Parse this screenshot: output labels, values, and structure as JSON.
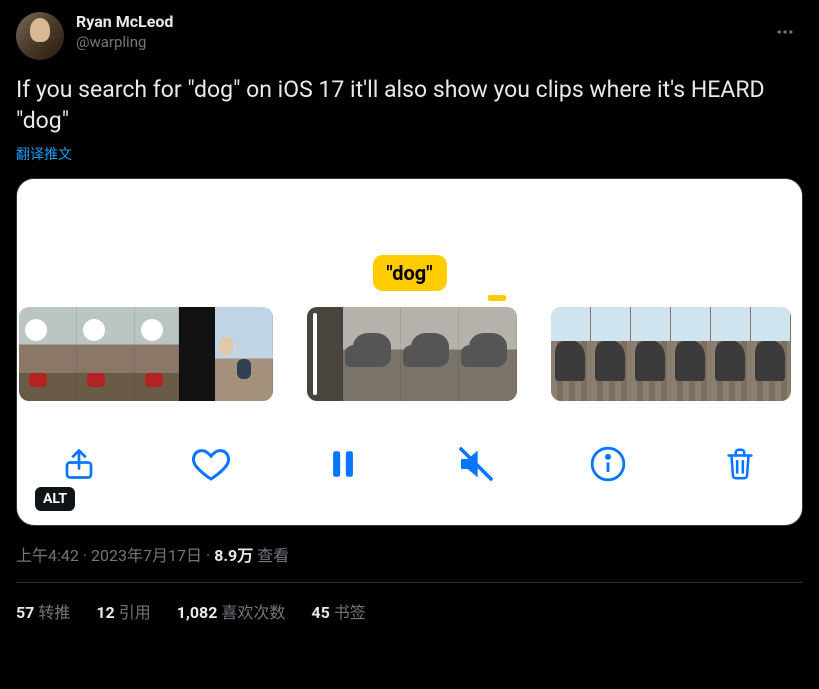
{
  "author": {
    "display_name": "Ryan McLeod",
    "handle": "@warpling"
  },
  "tweet_text": "If you search for \"dog\" on iOS 17 it'll also show you clips where it's HEARD \"dog\"",
  "translate_label": "翻译推文",
  "media": {
    "search_term": "\"dog\"",
    "alt_badge": "ALT",
    "toolbar_icons": [
      "share-icon",
      "heart-icon",
      "pause-icon",
      "mute-icon",
      "info-icon",
      "trash-icon"
    ]
  },
  "meta": {
    "time": "上午4:42",
    "date": "2023年7月17日",
    "views_count": "8.9万",
    "views_label": "查看"
  },
  "stats": {
    "retweets_count": "57",
    "retweets_label": "转推",
    "quotes_count": "12",
    "quotes_label": "引用",
    "likes_count": "1,082",
    "likes_label": "喜欢次数",
    "bookmarks_count": "45",
    "bookmarks_label": "书签"
  }
}
